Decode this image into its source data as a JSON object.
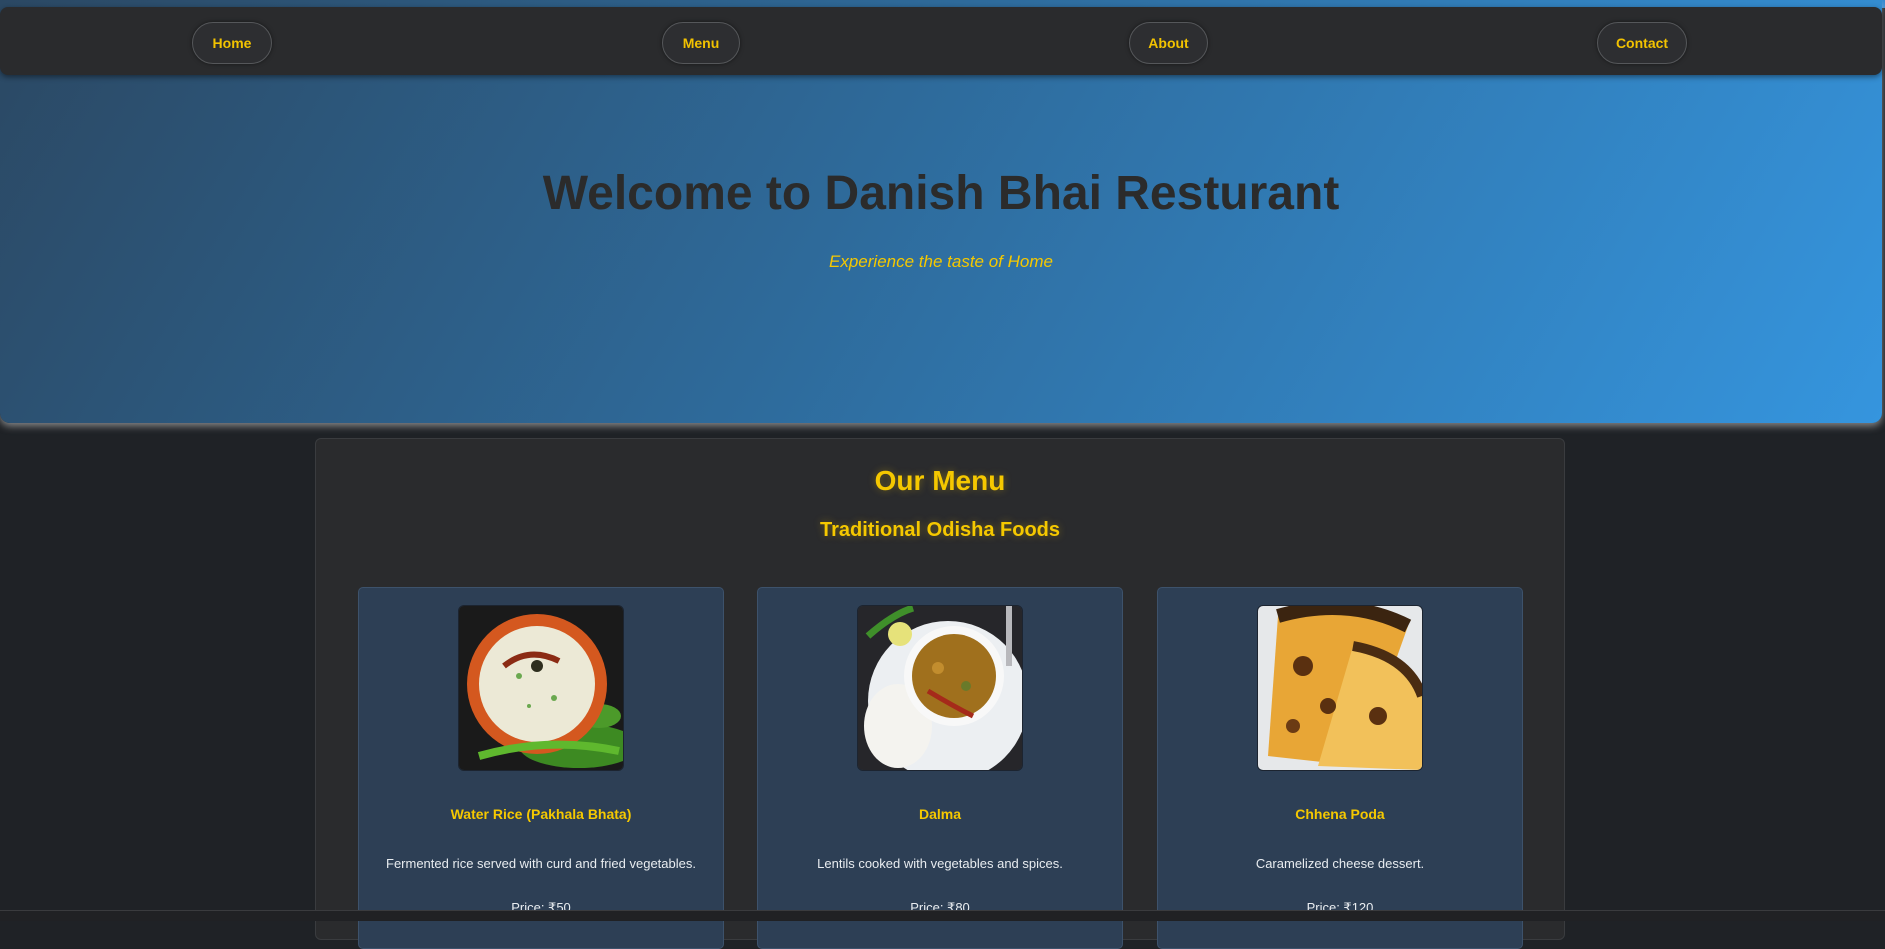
{
  "nav": {
    "items": [
      {
        "label": "Home"
      },
      {
        "label": "Menu"
      },
      {
        "label": "About"
      },
      {
        "label": "Contact"
      }
    ]
  },
  "hero": {
    "title": "Welcome to Danish Bhai Resturant",
    "subtitle": "Experience the taste of Home"
  },
  "menu": {
    "title": "Our Menu",
    "subtitle": "Traditional Odisha Foods",
    "items": [
      {
        "name": "Water Rice (Pakhala Bhata)",
        "description": "Fermented rice served with curd and fried vegetables.",
        "price": "Price: ₹50"
      },
      {
        "name": "Dalma",
        "description": "Lentils cooked with vegetables and spices.",
        "price": "Price: ₹80"
      },
      {
        "name": "Chhena Poda",
        "description": "Caramelized cheese dessert.",
        "price": "Price: ₹120"
      }
    ]
  },
  "colors": {
    "accent": "#f5c800",
    "nav_bg": "#2a2b2d",
    "card_bg": "#2d3f55",
    "page_bg": "#1f2226"
  }
}
